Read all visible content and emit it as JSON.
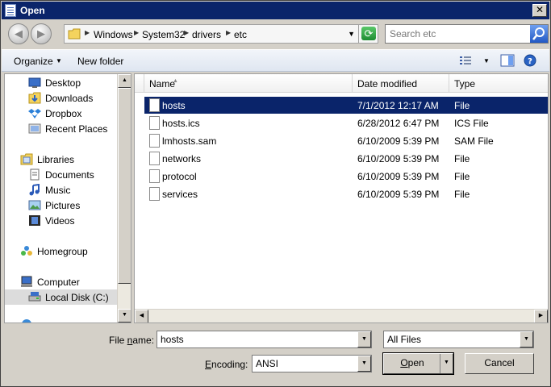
{
  "window": {
    "title": "Open"
  },
  "address": {
    "crumbs": [
      "Windows",
      "System32",
      "drivers",
      "etc"
    ]
  },
  "search": {
    "placeholder": "Search etc"
  },
  "toolbar": {
    "organize_label": "Organize",
    "new_folder_label": "New folder"
  },
  "nav": {
    "favorites": [
      {
        "label": "Desktop",
        "icon": "desktop-icon"
      },
      {
        "label": "Downloads",
        "icon": "downloads-icon"
      },
      {
        "label": "Dropbox",
        "icon": "dropbox-icon"
      },
      {
        "label": "Recent Places",
        "icon": "recent-places-icon"
      }
    ],
    "libraries_label": "Libraries",
    "libraries": [
      {
        "label": "Documents",
        "icon": "documents-icon"
      },
      {
        "label": "Music",
        "icon": "music-icon"
      },
      {
        "label": "Pictures",
        "icon": "pictures-icon"
      },
      {
        "label": "Videos",
        "icon": "videos-icon"
      }
    ],
    "homegroup_label": "Homegroup",
    "computer_label": "Computer",
    "local_disk_label": "Local Disk (C:)"
  },
  "columns": {
    "name": "Name",
    "date": "Date modified",
    "type": "Type"
  },
  "files": [
    {
      "name": "hosts",
      "date": "7/1/2012 12:17 AM",
      "type": "File",
      "selected": true
    },
    {
      "name": "hosts.ics",
      "date": "6/28/2012 6:47 PM",
      "type": "ICS File"
    },
    {
      "name": "lmhosts.sam",
      "date": "6/10/2009 5:39 PM",
      "type": "SAM File"
    },
    {
      "name": "networks",
      "date": "6/10/2009 5:39 PM",
      "type": "File"
    },
    {
      "name": "protocol",
      "date": "6/10/2009 5:39 PM",
      "type": "File"
    },
    {
      "name": "services",
      "date": "6/10/2009 5:39 PM",
      "type": "File"
    }
  ],
  "bottom": {
    "filename_label_pre": "File ",
    "filename_label_ul": "n",
    "filename_label_post": "ame:",
    "filename_value": "hosts",
    "filter_value": "All Files",
    "encoding_label_ul": "E",
    "encoding_label_post": "ncoding:",
    "encoding_value": "ANSI",
    "open_label_ul": "O",
    "open_label_post": "pen",
    "cancel_label": "Cancel"
  },
  "colors": {
    "title_bar": "#0a246a",
    "selection": "#0a246a"
  }
}
